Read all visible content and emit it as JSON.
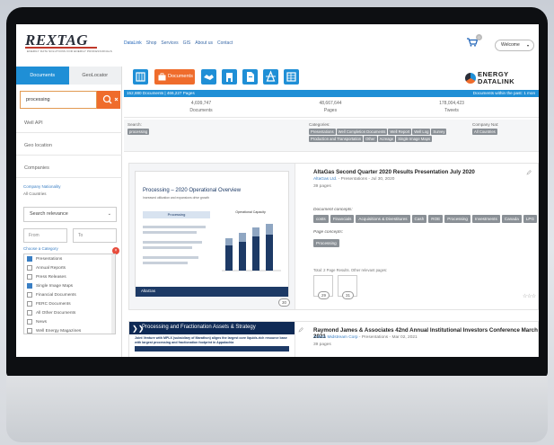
{
  "header": {
    "logo": "REXTAG",
    "logo_tagline": "ENERGY DATA SOLUTIONS FOR ENERGY PROFESSIONALS",
    "nav": [
      "DataLink",
      "Shop",
      "Services",
      "GIS",
      "About us",
      "Contact"
    ],
    "cart_count": "0",
    "welcome": "Welcome"
  },
  "sidebar": {
    "tabs": [
      "Documents",
      "GeoLocator"
    ],
    "search_value": "processing",
    "items": [
      "Well API",
      "Geo location",
      "Companies"
    ],
    "company_nationality_label": "Company Nationality",
    "company_nationality_value": "All Countries",
    "sort": "Search relevance",
    "from_placeholder": "From",
    "to_placeholder": "To",
    "choose_category": "Choose a Category",
    "categories": [
      {
        "label": "Presentations",
        "checked": true
      },
      {
        "label": "Annual Reports",
        "checked": false
      },
      {
        "label": "Press Releases",
        "checked": false
      },
      {
        "label": "Single Image Maps",
        "checked": true
      },
      {
        "label": "Financial Documents",
        "checked": false
      },
      {
        "label": "FERC Documents",
        "checked": false
      },
      {
        "label": "All Other Documents",
        "checked": false
      },
      {
        "label": "News",
        "checked": false
      },
      {
        "label": "Well Energy Magazines",
        "checked": false
      }
    ]
  },
  "toolbar": {
    "documents_label": "Documents",
    "brand_line1": "ENERGY",
    "brand_line2": "DATALINK"
  },
  "stats": {
    "summary": "152,880 Documents | 466,227 Pages",
    "right": "Documents within the past: 1 mon",
    "documents_count": "4,699,747",
    "documents_label": "Documents",
    "pages_count": "48,667,644",
    "pages_label": "Pages",
    "tweets_count": "178,004,423",
    "tweets_label": "Tweets"
  },
  "filters": {
    "search_label": "Search:",
    "search_chip": "processing",
    "categories_label": "Categories:",
    "categories_chips": [
      "Presentations",
      "Well Completion Documents",
      "Well Report",
      "Well Log",
      "Survey",
      "Production and Transportation",
      "Other",
      "Acreage",
      "Single Image Maps"
    ],
    "company_nat_label": "Company Nat:",
    "company_nat_chip": "All Countries"
  },
  "results": [
    {
      "title": "AltaGas Second Quarter 2020 Results Presentation July 2020",
      "company": "AltaGas Ltd.",
      "meta": " - Presentations - Jul 30, 2020",
      "pages": "39 pages",
      "doc_concepts_label": "Document concepts:",
      "doc_concepts": [
        "costs",
        "Financials",
        "Acquisitions & Divestitures",
        "Cash",
        "ROE",
        "Processing",
        "Investments",
        "Canada",
        "LPG"
      ],
      "page_concepts_label": "Page concepts:",
      "page_concepts": [
        "Processing"
      ],
      "total_pages_note": "Total: 2 Page Results. Other relevant pages:",
      "thumb_title": "Processing – 2020 Operational Overview",
      "thumb_subtitle": "Increased utilization and expansions drive growth",
      "thumb_section": "Processing",
      "thumb_chart_title": "Operational Capacity",
      "thumb_footer": "AltaGas",
      "page_number": "30",
      "mini_pages": [
        "29",
        "31"
      ]
    },
    {
      "title": "Raymond James & Associates 42nd Annual Institutional Investors Conference March 2021",
      "company": "Antero Midstream Corp",
      "meta": " - Presentations - Mar 02, 2021",
      "pages": "39 pages",
      "thumb_title": "Processing and Fractionation Assets & Strategy",
      "thumb_subtitle": "Joint Venture with MPLX (subsidiary of Marathon) aligns the largest core liquids-rich resource base with largest processing and fractionation footprint in Appalachia"
    }
  ]
}
